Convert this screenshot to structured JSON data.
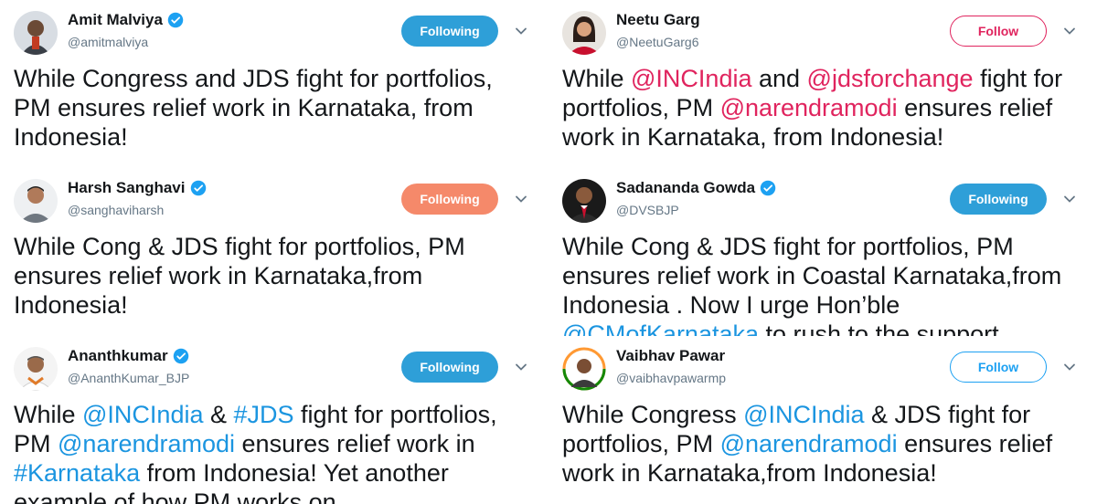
{
  "tweets": [
    {
      "name": "Amit Malviya",
      "handle": "@amitmalviya",
      "verified": true,
      "button": "Following",
      "parts": [
        {
          "t": "While Congress and JDS fight for portfolios, PM ensures relief work in Karnataka, from Indonesia!",
          "c": ""
        }
      ]
    },
    {
      "name": "Neetu Garg",
      "handle": "@NeetuGarg6",
      "verified": false,
      "button": "Follow",
      "parts": [
        {
          "t": "While ",
          "c": ""
        },
        {
          "t": "@INCIndia",
          "c": "lnk-red"
        },
        {
          "t": " and ",
          "c": ""
        },
        {
          "t": "@jdsforchange",
          "c": "lnk-red"
        },
        {
          "t": " fight for portfolios, PM ",
          "c": ""
        },
        {
          "t": "@narendramodi",
          "c": "lnk-red"
        },
        {
          "t": " ensures relief work in Karnataka, from Indonesia!",
          "c": ""
        }
      ]
    },
    {
      "name": "Harsh Sanghavi",
      "handle": "@sanghaviharsh",
      "verified": true,
      "button": "Following",
      "parts": [
        {
          "t": "While Cong & JDS fight for portfolios, PM ensures relief work in Karnataka,from Indonesia!",
          "c": ""
        }
      ]
    },
    {
      "name": "Sadananda Gowda",
      "handle": "@DVSBJP",
      "verified": true,
      "button": "Following",
      "parts": [
        {
          "t": "While Cong & JDS fight for portfolios, PM ensures relief work in Coastal Karnataka,from Indonesia . Now I urge Hon’ble ",
          "c": ""
        },
        {
          "t": "@CMofKarnataka",
          "c": "lnk"
        },
        {
          "t": " to rush to the support",
          "c": ""
        }
      ]
    },
    {
      "name": "Ananthkumar",
      "handle": "@AnanthKumar_BJP",
      "verified": true,
      "button": "Following",
      "parts": [
        {
          "t": "While ",
          "c": ""
        },
        {
          "t": "@INCIndia",
          "c": "lnk"
        },
        {
          "t": " & ",
          "c": ""
        },
        {
          "t": "#JDS",
          "c": "lnk"
        },
        {
          "t": " fight for portfolios, PM ",
          "c": ""
        },
        {
          "t": "@narendramodi",
          "c": "lnk"
        },
        {
          "t": " ensures relief work in ",
          "c": ""
        },
        {
          "t": "#Karnataka",
          "c": "lnk"
        },
        {
          "t": " from Indonesia! Yet another example of how PM works on",
          "c": ""
        }
      ]
    },
    {
      "name": "Vaibhav Pawar",
      "handle": "@vaibhavpawarmp",
      "verified": false,
      "button": "Follow",
      "parts": [
        {
          "t": "While Congress ",
          "c": ""
        },
        {
          "t": "@INCIndia",
          "c": "lnk"
        },
        {
          "t": " & JDS fight for portfolios, PM ",
          "c": ""
        },
        {
          "t": "@narendramodi",
          "c": "lnk"
        },
        {
          "t": " ensures relief work in Karnataka,from Indonesia!",
          "c": ""
        }
      ]
    }
  ],
  "colors": {
    "following": "#2e9fd8",
    "following_orange": "#f5896a",
    "follow_red": "#e0245e",
    "follow_blue": "#1da1f2",
    "link": "#1b95e0",
    "verified": "#1da1f2"
  }
}
